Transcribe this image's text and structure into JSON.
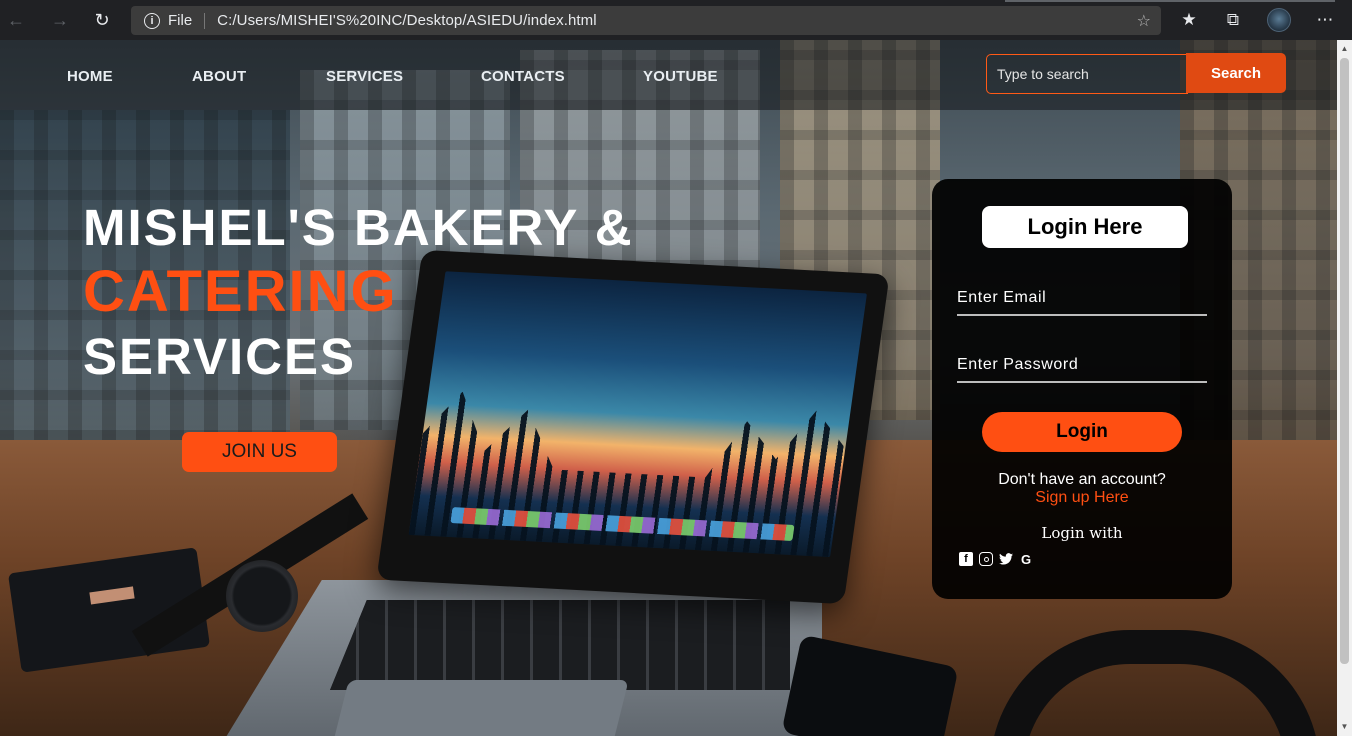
{
  "browser": {
    "scheme_label": "File",
    "url": "C:/Users/MISHEI'S%20INC/Desktop/ASIEDU/index.html",
    "icons": [
      "back-icon",
      "forward-icon",
      "reload-icon",
      "info-icon",
      "add-favorite-icon",
      "favorites-icon",
      "collections-icon",
      "profile-avatar",
      "more-icon"
    ]
  },
  "nav": {
    "items": [
      {
        "label": "HOME"
      },
      {
        "label": "ABOUT"
      },
      {
        "label": "SERVICES"
      },
      {
        "label": "CONTACTS"
      },
      {
        "label": "YOUTUBE"
      }
    ],
    "search_placeholder": "Type to search",
    "search_button": "Search"
  },
  "hero": {
    "line1": "MISHEL'S BAKERY &",
    "line2": "CATERING",
    "line3": "SERVICES",
    "cta": "JOIN US"
  },
  "login": {
    "title": "Login Here",
    "email_placeholder": "Enter Email",
    "password_placeholder": "Enter Password",
    "button": "Login",
    "no_account": "Don't have an account?",
    "signup": "Sign up Here",
    "login_with": "Login with",
    "social_icons": [
      "facebook-icon",
      "instagram-icon",
      "twitter-icon",
      "google-icon"
    ]
  },
  "colors": {
    "accent": "#ff4f12",
    "search_button": "#e04a12",
    "card_bg": "#000000",
    "chrome_bg": "#202124"
  }
}
